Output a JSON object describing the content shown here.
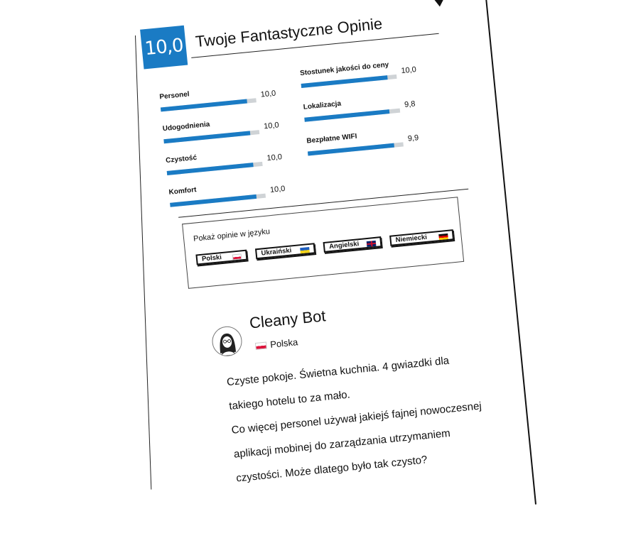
{
  "header": {
    "score": "10,0",
    "title": "Twoje Fantastyczne Opinie"
  },
  "metrics_left": [
    {
      "label": "Personel",
      "value": "10,0",
      "fill": 0.9
    },
    {
      "label": "Udogodnienia",
      "value": "10,0",
      "fill": 0.9
    },
    {
      "label": "Czystość",
      "value": "10,0",
      "fill": 0.9
    },
    {
      "label": "Komfort",
      "value": "10,0",
      "fill": 0.9
    }
  ],
  "metrics_right": [
    {
      "label": "Stostunek jakości do ceny",
      "value": "10,0",
      "fill": 0.9
    },
    {
      "label": "Lokalizacja",
      "value": "9,8",
      "fill": 0.89
    },
    {
      "label": "Bezpłatne WIFI",
      "value": "9,9",
      "fill": 0.9
    }
  ],
  "languages": {
    "title": "Pokaż opinie w języku",
    "buttons": [
      {
        "label": "Polski",
        "flag": "poland-flag-icon"
      },
      {
        "label": "Ukraiński",
        "flag": "ukraine-flag-icon"
      },
      {
        "label": "Angielski",
        "flag": "uk-flag-icon"
      },
      {
        "label": "Niemiecki",
        "flag": "germany-flag-icon"
      }
    ]
  },
  "review": {
    "reviewer": "Cleany Bot",
    "country": "Polska",
    "lines": [
      "Czyste pokoje. Świetna kuchnia. 4 gwiazdki dla",
      "takiego hotelu to za mało.",
      "Co więcej personel używał jakiejś fajnej nowoczesnej",
      "aplikacji mobinej do zarządzania utrzymaniem",
      "czystości. Może dlatego było tak czysto?"
    ]
  },
  "colors": {
    "accent": "#1a7bc4",
    "bar_track": "#cfd3d6"
  }
}
